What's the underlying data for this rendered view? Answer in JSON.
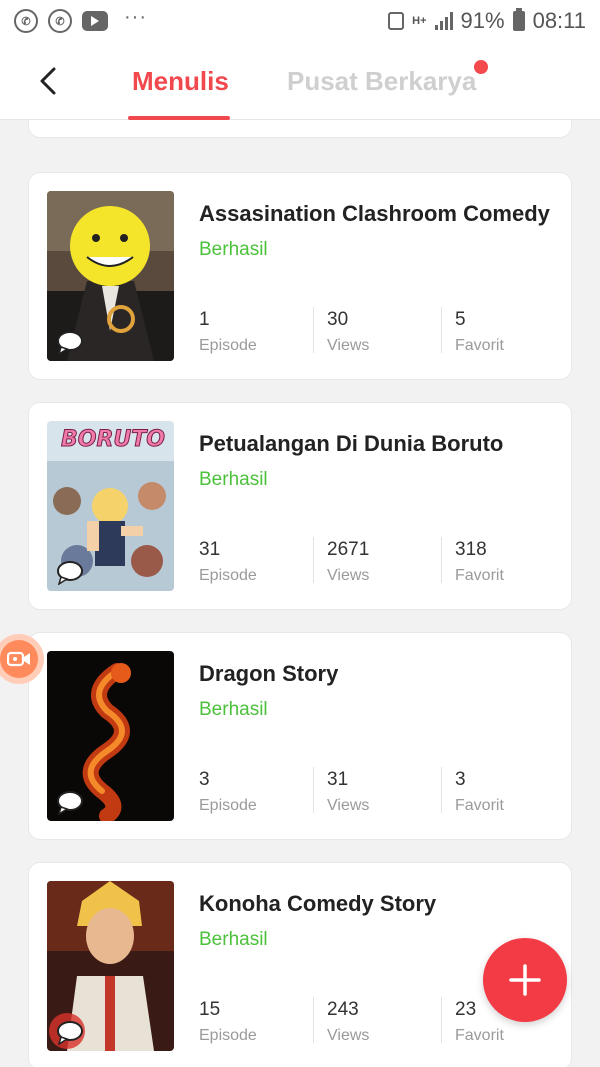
{
  "status_bar": {
    "network": "H+",
    "battery": "91%",
    "time": "08:11"
  },
  "header": {
    "tab_active": "Menulis",
    "tab_inactive": "Pusat Berkarya"
  },
  "stat_labels": {
    "episode": "Episode",
    "views": "Views",
    "favorit": "Favorit"
  },
  "stories": [
    {
      "title": "Assasination Clashroom Comedy",
      "status": "Berhasil",
      "episodes": "1",
      "views": "30",
      "favorit": "5"
    },
    {
      "title": "Petualangan Di Dunia Boruto",
      "status": "Berhasil",
      "episodes": "31",
      "views": "2671",
      "favorit": "318"
    },
    {
      "title": "Dragon Story",
      "status": "Berhasil",
      "episodes": "3",
      "views": "31",
      "favorit": "3"
    },
    {
      "title": "Konoha Comedy Story",
      "status": "Berhasil",
      "episodes": "15",
      "views": "243",
      "favorit": "23"
    }
  ],
  "covers": {
    "boruto_logo": "BORUTO"
  },
  "colors": {
    "accent": "#f0484d",
    "success": "#4cc13b",
    "fab": "#f23b44"
  }
}
